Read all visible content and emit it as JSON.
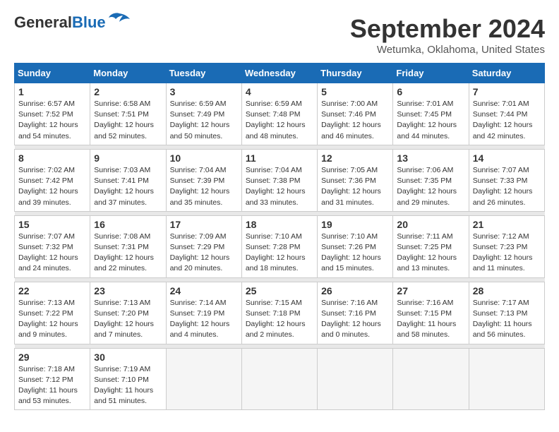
{
  "logo": {
    "line1": "General",
    "line2": "Blue"
  },
  "title": "September 2024",
  "location": "Wetumka, Oklahoma, United States",
  "days_of_week": [
    "Sunday",
    "Monday",
    "Tuesday",
    "Wednesday",
    "Thursday",
    "Friday",
    "Saturday"
  ],
  "weeks": [
    [
      {
        "day": "1",
        "info": "Sunrise: 6:57 AM\nSunset: 7:52 PM\nDaylight: 12 hours\nand 54 minutes."
      },
      {
        "day": "2",
        "info": "Sunrise: 6:58 AM\nSunset: 7:51 PM\nDaylight: 12 hours\nand 52 minutes."
      },
      {
        "day": "3",
        "info": "Sunrise: 6:59 AM\nSunset: 7:49 PM\nDaylight: 12 hours\nand 50 minutes."
      },
      {
        "day": "4",
        "info": "Sunrise: 6:59 AM\nSunset: 7:48 PM\nDaylight: 12 hours\nand 48 minutes."
      },
      {
        "day": "5",
        "info": "Sunrise: 7:00 AM\nSunset: 7:46 PM\nDaylight: 12 hours\nand 46 minutes."
      },
      {
        "day": "6",
        "info": "Sunrise: 7:01 AM\nSunset: 7:45 PM\nDaylight: 12 hours\nand 44 minutes."
      },
      {
        "day": "7",
        "info": "Sunrise: 7:01 AM\nSunset: 7:44 PM\nDaylight: 12 hours\nand 42 minutes."
      }
    ],
    [
      {
        "day": "8",
        "info": "Sunrise: 7:02 AM\nSunset: 7:42 PM\nDaylight: 12 hours\nand 39 minutes."
      },
      {
        "day": "9",
        "info": "Sunrise: 7:03 AM\nSunset: 7:41 PM\nDaylight: 12 hours\nand 37 minutes."
      },
      {
        "day": "10",
        "info": "Sunrise: 7:04 AM\nSunset: 7:39 PM\nDaylight: 12 hours\nand 35 minutes."
      },
      {
        "day": "11",
        "info": "Sunrise: 7:04 AM\nSunset: 7:38 PM\nDaylight: 12 hours\nand 33 minutes."
      },
      {
        "day": "12",
        "info": "Sunrise: 7:05 AM\nSunset: 7:36 PM\nDaylight: 12 hours\nand 31 minutes."
      },
      {
        "day": "13",
        "info": "Sunrise: 7:06 AM\nSunset: 7:35 PM\nDaylight: 12 hours\nand 29 minutes."
      },
      {
        "day": "14",
        "info": "Sunrise: 7:07 AM\nSunset: 7:33 PM\nDaylight: 12 hours\nand 26 minutes."
      }
    ],
    [
      {
        "day": "15",
        "info": "Sunrise: 7:07 AM\nSunset: 7:32 PM\nDaylight: 12 hours\nand 24 minutes."
      },
      {
        "day": "16",
        "info": "Sunrise: 7:08 AM\nSunset: 7:31 PM\nDaylight: 12 hours\nand 22 minutes."
      },
      {
        "day": "17",
        "info": "Sunrise: 7:09 AM\nSunset: 7:29 PM\nDaylight: 12 hours\nand 20 minutes."
      },
      {
        "day": "18",
        "info": "Sunrise: 7:10 AM\nSunset: 7:28 PM\nDaylight: 12 hours\nand 18 minutes."
      },
      {
        "day": "19",
        "info": "Sunrise: 7:10 AM\nSunset: 7:26 PM\nDaylight: 12 hours\nand 15 minutes."
      },
      {
        "day": "20",
        "info": "Sunrise: 7:11 AM\nSunset: 7:25 PM\nDaylight: 12 hours\nand 13 minutes."
      },
      {
        "day": "21",
        "info": "Sunrise: 7:12 AM\nSunset: 7:23 PM\nDaylight: 12 hours\nand 11 minutes."
      }
    ],
    [
      {
        "day": "22",
        "info": "Sunrise: 7:13 AM\nSunset: 7:22 PM\nDaylight: 12 hours\nand 9 minutes."
      },
      {
        "day": "23",
        "info": "Sunrise: 7:13 AM\nSunset: 7:20 PM\nDaylight: 12 hours\nand 7 minutes."
      },
      {
        "day": "24",
        "info": "Sunrise: 7:14 AM\nSunset: 7:19 PM\nDaylight: 12 hours\nand 4 minutes."
      },
      {
        "day": "25",
        "info": "Sunrise: 7:15 AM\nSunset: 7:18 PM\nDaylight: 12 hours\nand 2 minutes."
      },
      {
        "day": "26",
        "info": "Sunrise: 7:16 AM\nSunset: 7:16 PM\nDaylight: 12 hours\nand 0 minutes."
      },
      {
        "day": "27",
        "info": "Sunrise: 7:16 AM\nSunset: 7:15 PM\nDaylight: 11 hours\nand 58 minutes."
      },
      {
        "day": "28",
        "info": "Sunrise: 7:17 AM\nSunset: 7:13 PM\nDaylight: 11 hours\nand 56 minutes."
      }
    ],
    [
      {
        "day": "29",
        "info": "Sunrise: 7:18 AM\nSunset: 7:12 PM\nDaylight: 11 hours\nand 53 minutes."
      },
      {
        "day": "30",
        "info": "Sunrise: 7:19 AM\nSunset: 7:10 PM\nDaylight: 11 hours\nand 51 minutes."
      },
      {
        "day": "",
        "info": ""
      },
      {
        "day": "",
        "info": ""
      },
      {
        "day": "",
        "info": ""
      },
      {
        "day": "",
        "info": ""
      },
      {
        "day": "",
        "info": ""
      }
    ]
  ]
}
